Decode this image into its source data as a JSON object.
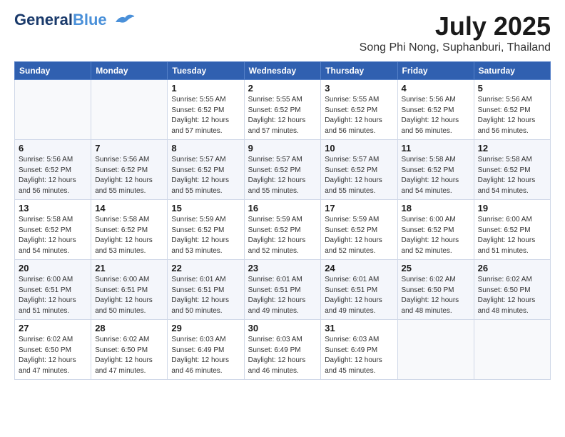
{
  "header": {
    "logo_line1": "General",
    "logo_line2": "Blue",
    "month": "July 2025",
    "location": "Song Phi Nong, Suphanburi, Thailand"
  },
  "weekdays": [
    "Sunday",
    "Monday",
    "Tuesday",
    "Wednesday",
    "Thursday",
    "Friday",
    "Saturday"
  ],
  "weeks": [
    [
      {
        "day": "",
        "info": ""
      },
      {
        "day": "",
        "info": ""
      },
      {
        "day": "1",
        "info": "Sunrise: 5:55 AM\nSunset: 6:52 PM\nDaylight: 12 hours and 57 minutes."
      },
      {
        "day": "2",
        "info": "Sunrise: 5:55 AM\nSunset: 6:52 PM\nDaylight: 12 hours and 57 minutes."
      },
      {
        "day": "3",
        "info": "Sunrise: 5:55 AM\nSunset: 6:52 PM\nDaylight: 12 hours and 56 minutes."
      },
      {
        "day": "4",
        "info": "Sunrise: 5:56 AM\nSunset: 6:52 PM\nDaylight: 12 hours and 56 minutes."
      },
      {
        "day": "5",
        "info": "Sunrise: 5:56 AM\nSunset: 6:52 PM\nDaylight: 12 hours and 56 minutes."
      }
    ],
    [
      {
        "day": "6",
        "info": "Sunrise: 5:56 AM\nSunset: 6:52 PM\nDaylight: 12 hours and 56 minutes."
      },
      {
        "day": "7",
        "info": "Sunrise: 5:56 AM\nSunset: 6:52 PM\nDaylight: 12 hours and 55 minutes."
      },
      {
        "day": "8",
        "info": "Sunrise: 5:57 AM\nSunset: 6:52 PM\nDaylight: 12 hours and 55 minutes."
      },
      {
        "day": "9",
        "info": "Sunrise: 5:57 AM\nSunset: 6:52 PM\nDaylight: 12 hours and 55 minutes."
      },
      {
        "day": "10",
        "info": "Sunrise: 5:57 AM\nSunset: 6:52 PM\nDaylight: 12 hours and 55 minutes."
      },
      {
        "day": "11",
        "info": "Sunrise: 5:58 AM\nSunset: 6:52 PM\nDaylight: 12 hours and 54 minutes."
      },
      {
        "day": "12",
        "info": "Sunrise: 5:58 AM\nSunset: 6:52 PM\nDaylight: 12 hours and 54 minutes."
      }
    ],
    [
      {
        "day": "13",
        "info": "Sunrise: 5:58 AM\nSunset: 6:52 PM\nDaylight: 12 hours and 54 minutes."
      },
      {
        "day": "14",
        "info": "Sunrise: 5:58 AM\nSunset: 6:52 PM\nDaylight: 12 hours and 53 minutes."
      },
      {
        "day": "15",
        "info": "Sunrise: 5:59 AM\nSunset: 6:52 PM\nDaylight: 12 hours and 53 minutes."
      },
      {
        "day": "16",
        "info": "Sunrise: 5:59 AM\nSunset: 6:52 PM\nDaylight: 12 hours and 52 minutes."
      },
      {
        "day": "17",
        "info": "Sunrise: 5:59 AM\nSunset: 6:52 PM\nDaylight: 12 hours and 52 minutes."
      },
      {
        "day": "18",
        "info": "Sunrise: 6:00 AM\nSunset: 6:52 PM\nDaylight: 12 hours and 52 minutes."
      },
      {
        "day": "19",
        "info": "Sunrise: 6:00 AM\nSunset: 6:52 PM\nDaylight: 12 hours and 51 minutes."
      }
    ],
    [
      {
        "day": "20",
        "info": "Sunrise: 6:00 AM\nSunset: 6:51 PM\nDaylight: 12 hours and 51 minutes."
      },
      {
        "day": "21",
        "info": "Sunrise: 6:00 AM\nSunset: 6:51 PM\nDaylight: 12 hours and 50 minutes."
      },
      {
        "day": "22",
        "info": "Sunrise: 6:01 AM\nSunset: 6:51 PM\nDaylight: 12 hours and 50 minutes."
      },
      {
        "day": "23",
        "info": "Sunrise: 6:01 AM\nSunset: 6:51 PM\nDaylight: 12 hours and 49 minutes."
      },
      {
        "day": "24",
        "info": "Sunrise: 6:01 AM\nSunset: 6:51 PM\nDaylight: 12 hours and 49 minutes."
      },
      {
        "day": "25",
        "info": "Sunrise: 6:02 AM\nSunset: 6:50 PM\nDaylight: 12 hours and 48 minutes."
      },
      {
        "day": "26",
        "info": "Sunrise: 6:02 AM\nSunset: 6:50 PM\nDaylight: 12 hours and 48 minutes."
      }
    ],
    [
      {
        "day": "27",
        "info": "Sunrise: 6:02 AM\nSunset: 6:50 PM\nDaylight: 12 hours and 47 minutes."
      },
      {
        "day": "28",
        "info": "Sunrise: 6:02 AM\nSunset: 6:50 PM\nDaylight: 12 hours and 47 minutes."
      },
      {
        "day": "29",
        "info": "Sunrise: 6:03 AM\nSunset: 6:49 PM\nDaylight: 12 hours and 46 minutes."
      },
      {
        "day": "30",
        "info": "Sunrise: 6:03 AM\nSunset: 6:49 PM\nDaylight: 12 hours and 46 minutes."
      },
      {
        "day": "31",
        "info": "Sunrise: 6:03 AM\nSunset: 6:49 PM\nDaylight: 12 hours and 45 minutes."
      },
      {
        "day": "",
        "info": ""
      },
      {
        "day": "",
        "info": ""
      }
    ]
  ]
}
